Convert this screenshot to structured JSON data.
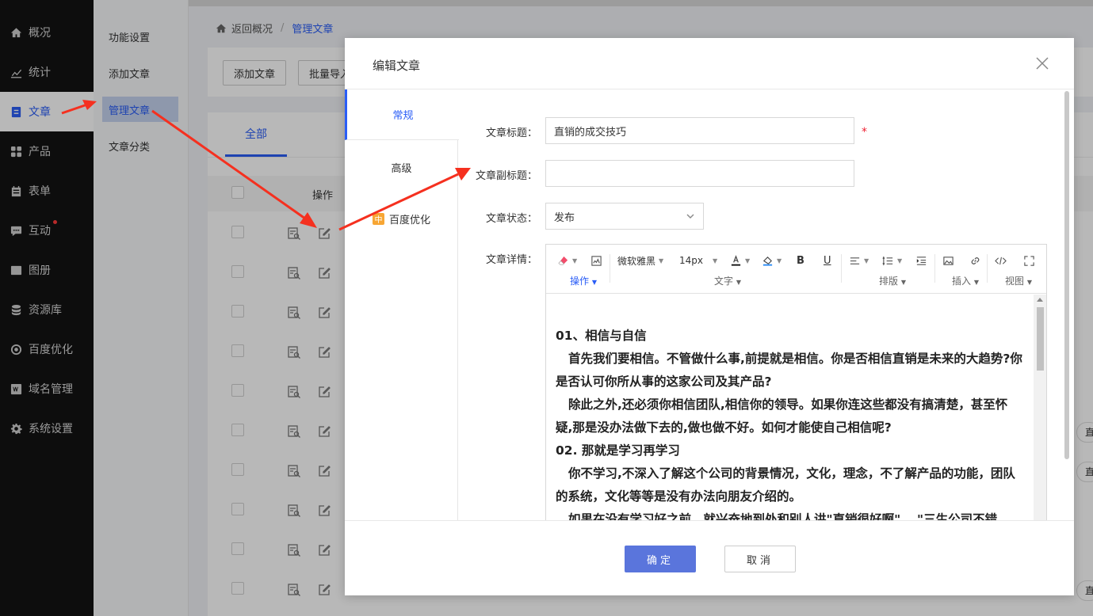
{
  "sidebar": {
    "items": [
      {
        "label": "概况",
        "icon": "home-icon"
      },
      {
        "label": "统计",
        "icon": "chart-icon"
      },
      {
        "label": "文章",
        "icon": "article-icon"
      },
      {
        "label": "产品",
        "icon": "product-icon"
      },
      {
        "label": "表单",
        "icon": "form-icon"
      },
      {
        "label": "互动",
        "icon": "chat-icon"
      },
      {
        "label": "图册",
        "icon": "album-icon"
      },
      {
        "label": "资源库",
        "icon": "database-icon"
      },
      {
        "label": "百度优化",
        "icon": "target-icon"
      },
      {
        "label": "域名管理",
        "icon": "domain-icon"
      },
      {
        "label": "系统设置",
        "icon": "gear-icon"
      }
    ]
  },
  "submenu": {
    "items": [
      "功能设置",
      "添加文章",
      "管理文章",
      "文章分类"
    ]
  },
  "breadcrumb": {
    "back": "返回概况",
    "sep": "/",
    "current": "管理文章"
  },
  "toolbar": {
    "add_label": "添加文章",
    "import_label": "批量导入"
  },
  "list": {
    "tab_all": "全部",
    "op_header": "操作"
  },
  "right_pill_text": "直",
  "modal": {
    "title": "编辑文章",
    "tabs": [
      "常规",
      "高级",
      "百度优化"
    ],
    "baidu_badge": "中",
    "fields": {
      "title_label": "文章标题：",
      "title_value": "直销的成交技巧",
      "required_mark": "*",
      "subtitle_label": "文章副标题：",
      "subtitle_value": "",
      "status_label": "文章状态：",
      "status_value": "发布",
      "detail_label": "文章详情："
    },
    "editor_toolbar": {
      "font_family": "微软雅黑",
      "font_size": "14px",
      "group_ops": "操作",
      "group_text": "文字",
      "group_layout": "排版",
      "group_insert": "插入",
      "group_view": "视图"
    },
    "editor_content": [
      "01、相信与自信",
      "首先我们要相信。不管做什么事,前提就是相信。你是否相信直销是未来的大趋势?你是否认可你所从事的这家公司及其产品?",
      "除此之外,还必须你相信团队,相信你的领导。如果你连这些都没有搞清楚，甚至怀疑,那是没办法做下去的,做也做不好。如何才能使自己相信呢?",
      "02. 那就是学习再学习",
      "你不学习,不深入了解这个公司的背景情况，文化，理念，不了解产品的功能，团队的系统，文化等等是没有办法向朋友介绍的。",
      "如果在没有学习好之前，就兴奋地到处和别人讲\"直销很好啊\"，  \"三生公司不错"
    ],
    "ok_label": "确定",
    "cancel_label": "取消"
  },
  "colors": {
    "accent": "#2a5df6",
    "ok_button": "#5a75dc",
    "annotation_arrow": "#f5301f"
  }
}
